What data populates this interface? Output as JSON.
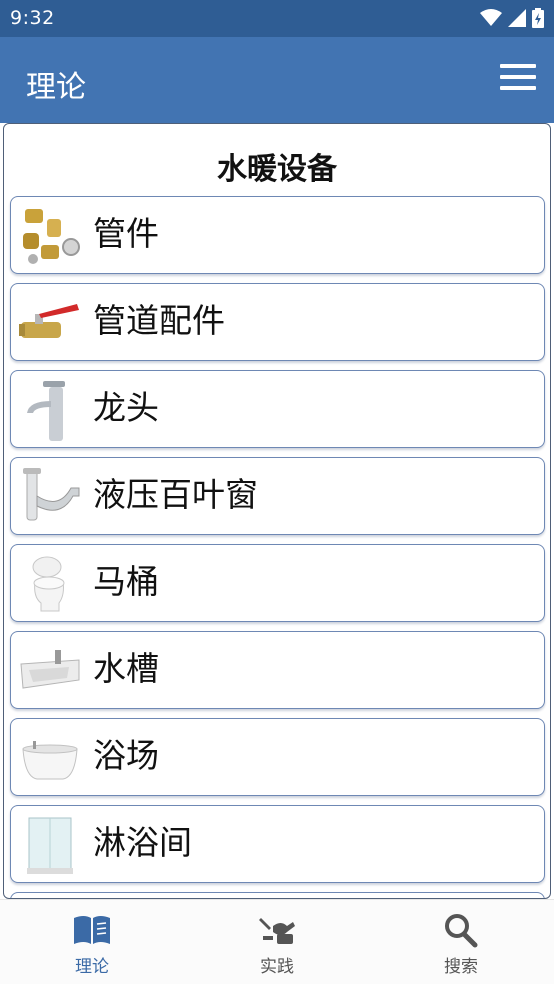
{
  "status": {
    "time": "9:32"
  },
  "app_bar": {
    "title": "理论"
  },
  "section": {
    "title": "水暖设备"
  },
  "items": [
    {
      "label": "管件",
      "icon": "fittings-icon"
    },
    {
      "label": "管道配件",
      "icon": "ball-valve-icon"
    },
    {
      "label": "龙头",
      "icon": "faucet-icon"
    },
    {
      "label": "液压百叶窗",
      "icon": "siphon-icon"
    },
    {
      "label": "马桶",
      "icon": "toilet-icon"
    },
    {
      "label": "水槽",
      "icon": "sink-icon"
    },
    {
      "label": "浴场",
      "icon": "bathtub-icon"
    },
    {
      "label": "淋浴间",
      "icon": "shower-cabin-icon"
    }
  ],
  "bottom_nav": {
    "theory": "理论",
    "practice": "实践",
    "search": "搜索",
    "active_color": "#3b6aa6",
    "inactive_color": "#555555"
  }
}
